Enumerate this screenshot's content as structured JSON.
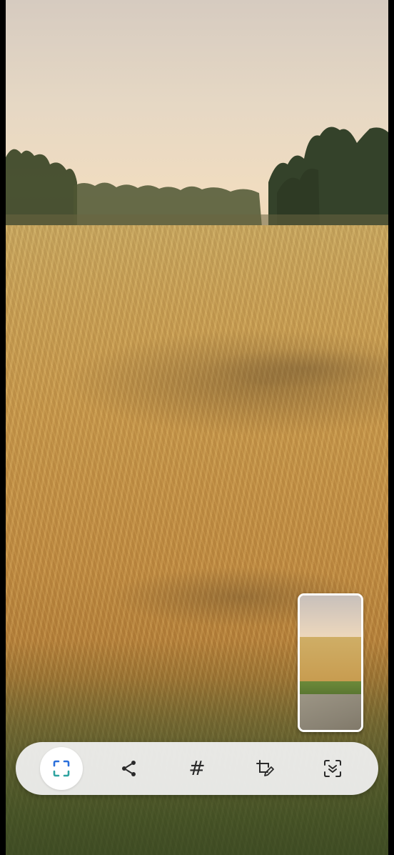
{
  "photo": {
    "scene": "wheat-field-at-sunset"
  },
  "thumbnail": {
    "icon": "screenshot-preview-thumbnail"
  },
  "toolbar": {
    "items": [
      {
        "id": "capture-more",
        "icon": "scroll-capture-icon",
        "active": true
      },
      {
        "id": "share",
        "icon": "share-icon",
        "active": false
      },
      {
        "id": "tags",
        "icon": "hashtag-icon",
        "label": "#",
        "active": false
      },
      {
        "id": "edit",
        "icon": "crop-edit-icon",
        "active": false
      },
      {
        "id": "extract",
        "icon": "scan-text-icon",
        "active": false
      }
    ],
    "accent_color": "#2a6fdb",
    "icon_color": "#2a2a2a"
  }
}
